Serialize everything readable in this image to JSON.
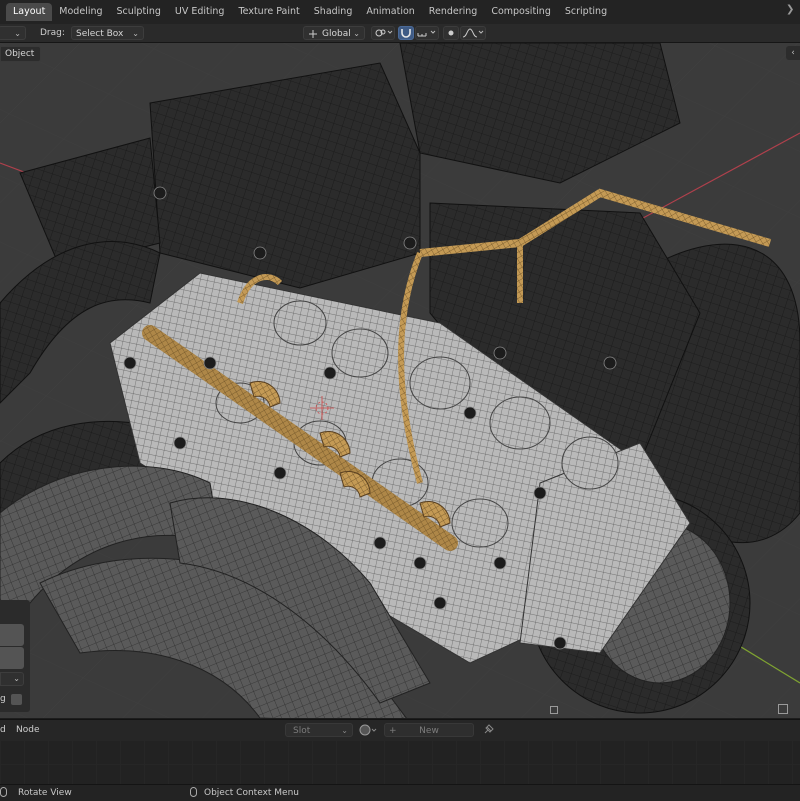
{
  "workspace_tabs": [
    {
      "label": "Layout",
      "active": true
    },
    {
      "label": "Modeling"
    },
    {
      "label": "Sculpting"
    },
    {
      "label": "UV Editing"
    },
    {
      "label": "Texture Paint"
    },
    {
      "label": "Shading"
    },
    {
      "label": "Animation"
    },
    {
      "label": "Rendering"
    },
    {
      "label": "Compositing"
    },
    {
      "label": "Scripting"
    }
  ],
  "header": {
    "drag_label": "Drag:",
    "drag_value": "Select Box",
    "transform_orientation": "Global"
  },
  "viewport": {
    "object_mode_label": "Object",
    "colors": {
      "background": "#3c3c3c",
      "x_axis": "#b0404c",
      "y_axis": "#7fa331",
      "mesh_dark": "#2a2a2a",
      "mesh_light": "#bdbdbd",
      "brass": "#c9a05c"
    }
  },
  "operator_panel": {
    "checkbox_label_fragment": "g"
  },
  "shader_editor": {
    "left_fragment": "d",
    "node_menu": "Node",
    "slot_placeholder": "Slot",
    "new_button": "New"
  },
  "status_bar": {
    "left_fragment": "",
    "rotate_view": "Rotate View",
    "context_menu": "Object Context Menu"
  }
}
